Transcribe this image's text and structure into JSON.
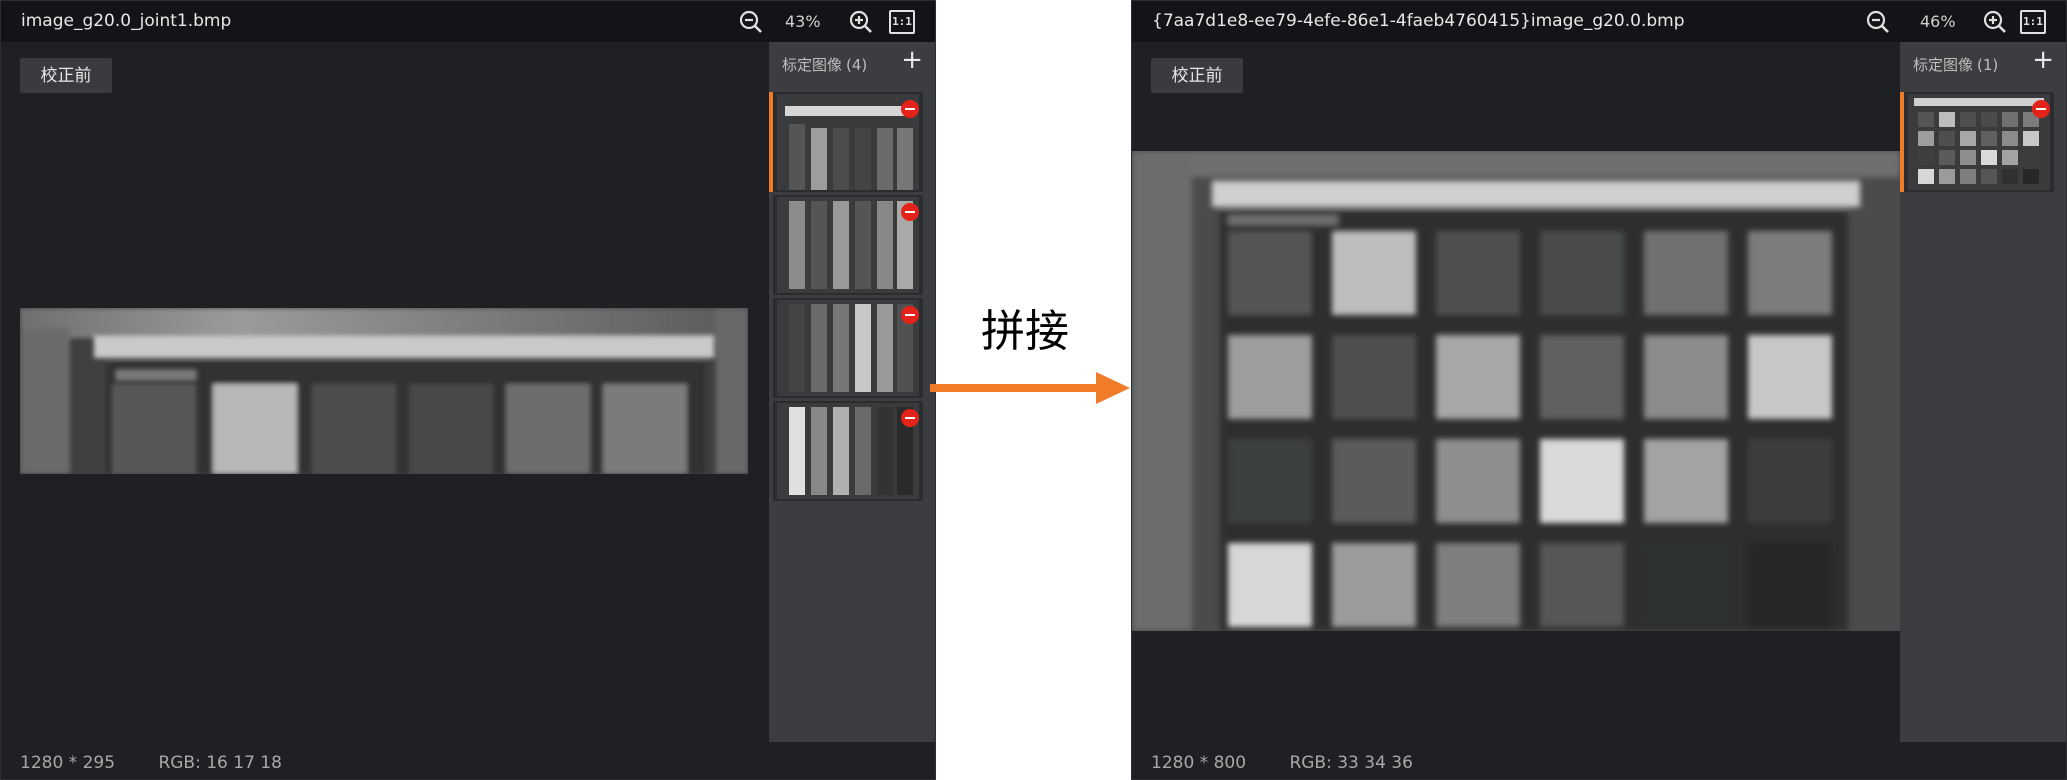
{
  "left": {
    "filename": "image_g20.0_joint1.bmp",
    "zoom": "43%",
    "fit_label": "1:1",
    "calib_button": "校正前",
    "sidebar": {
      "title": "标定图像",
      "count": "(4)",
      "add": "+"
    },
    "thumbnails": 4,
    "status": {
      "size": "1280 * 295",
      "rgb": "RGB: 16 17 18"
    }
  },
  "right": {
    "filename": "{7aa7d1e8-ee79-4efe-86e1-4faeb4760415}image_g20.0.bmp",
    "zoom": "46%",
    "fit_label": "1:1",
    "calib_button": "校正前",
    "sidebar": {
      "title": "标定图像",
      "count": "(1)",
      "add": "+"
    },
    "thumbnails": 1,
    "status": {
      "size": "1280 * 800",
      "rgb": "RGB: 33 34 36"
    }
  },
  "middle": {
    "label": "拼接"
  },
  "colors": {
    "accent": "#f07c2a",
    "delete": "#e2231a",
    "panel_bg": "#1f2023",
    "sidebar_bg": "#3c3d41"
  },
  "icons": [
    "zoom-out-icon",
    "zoom-in-icon",
    "actual-size-icon",
    "add-icon",
    "remove-icon",
    "arrow-right-icon"
  ]
}
